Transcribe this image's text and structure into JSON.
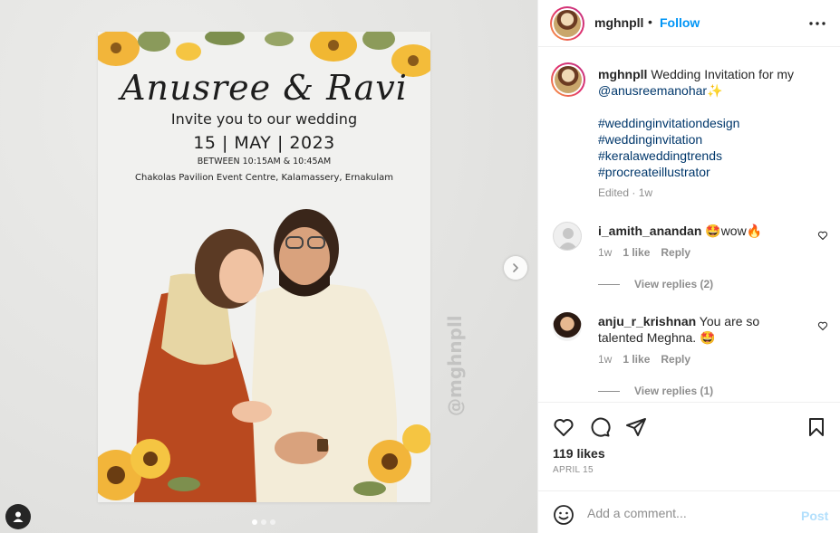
{
  "post": {
    "username": "mghnpll",
    "separator": "•",
    "follow_label": "Follow",
    "caption_text": "Wedding Invitation for my",
    "caption_mention": "@anusreemanohar",
    "caption_emoji": "✨",
    "hashtags": [
      "#weddinginvitationdesign",
      "#weddinginvitation",
      "#keralaweddingtrends",
      "#procreateillustrator"
    ],
    "caption_meta": "Edited · 1w",
    "likes": "119 likes",
    "date": "APRIL 15"
  },
  "invitation": {
    "names": "Anusree & Ravi",
    "invite_line": "Invite you to our wedding",
    "date_line": "15 | MAY | 2023",
    "time_line": "BETWEEN 10:15AM & 10:45AM",
    "venue_line": "Chakolas Pavilion Event Centre, Kalamassery, Ernakulam",
    "watermark": "@mghnpll"
  },
  "comments": [
    {
      "username": "i_amith_anandan",
      "text": "🤩wow🔥",
      "age": "1w",
      "likes": "1 like",
      "reply_label": "Reply",
      "view_replies": "View replies (2)"
    },
    {
      "username": "anju_r_krishnan",
      "text": "You are so talented Meghna. 🤩",
      "age": "1w",
      "likes": "1 like",
      "reply_label": "Reply",
      "view_replies": "View replies (1)"
    }
  ],
  "add_comment": {
    "placeholder": "Add a comment...",
    "post_label": "Post"
  },
  "colors": {
    "link_blue": "#0095f6",
    "mention_blue": "#00376b",
    "muted_gray": "#8e8e8e",
    "post_disabled": "#b2dffc"
  },
  "icons": {
    "more": "more-options-icon",
    "next": "chevron-right-icon",
    "tag": "user-tag-icon",
    "like": "heart-icon",
    "comment": "comment-bubble-icon",
    "share": "paper-plane-icon",
    "save": "bookmark-icon",
    "emoji": "emoji-smile-icon"
  }
}
